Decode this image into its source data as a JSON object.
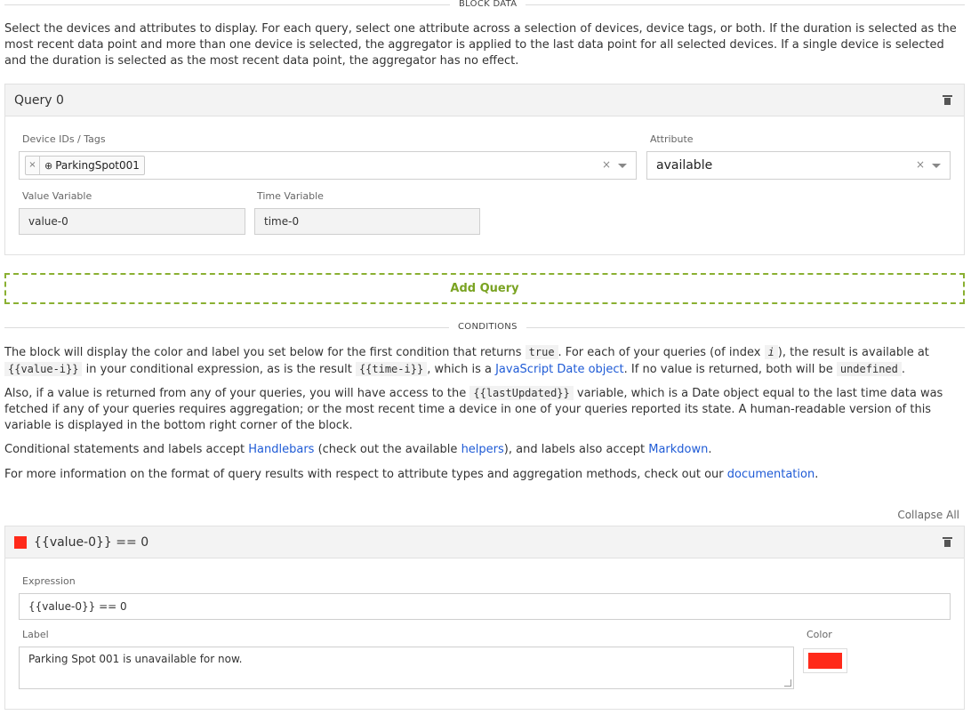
{
  "block_data": {
    "section_title": "BLOCK DATA",
    "intro": "Select the devices and attributes to display. For each query, select one attribute across a selection of devices, device tags, or both. If the duration is selected as the most recent data point and more than one device is selected, the aggregator is applied to the last data point for all selected devices. If a single device is selected and the duration is selected as the most recent data point, the aggregator has no effect."
  },
  "query": {
    "title": "Query 0",
    "device_label": "Device IDs / Tags",
    "device_chip": "ParkingSpot001",
    "device_chip_remove": "×",
    "device_chip_icon": "⊕",
    "attribute_label": "Attribute",
    "attribute_value": "available",
    "clear_symbol": "×",
    "value_var_label": "Value Variable",
    "value_var": "value-0",
    "time_var_label": "Time Variable",
    "time_var": "time-0"
  },
  "add_query_label": "Add Query",
  "conditions": {
    "section_title": "CONDITIONS",
    "p1_a": "The block will display the color and label you set below for the first condition that returns ",
    "p1_code1": "true",
    "p1_b": ". For each of your queries (of index ",
    "p1_code2": "i",
    "p1_c": "), the result is available at ",
    "p1_code3": "{{value-i}}",
    "p1_d": " in your conditional expression, as is the result ",
    "p1_code4": "{{time-i}}",
    "p1_e": ", which is a ",
    "p1_link": "JavaScript Date object",
    "p1_f": ". If no value is returned, both will be ",
    "p1_code5": "undefined",
    "p1_g": ".",
    "p2_a": "Also, if a value is returned from any of your queries, you will have access to the ",
    "p2_code": "{{lastUpdated}}",
    "p2_b": " variable, which is a Date object equal to the last time data was fetched if any of your queries requires aggregation; or the most recent time a device in one of your queries reported its state. A human-readable version of this variable is displayed in the bottom right corner of the block.",
    "p3_a": "Conditional statements and labels accept ",
    "p3_link1": "Handlebars",
    "p3_b": " (check out the available ",
    "p3_link2": "helpers",
    "p3_c": "), and labels also accept ",
    "p3_link3": "Markdown",
    "p3_d": ".",
    "p4_a": "For more information on the format of query results with respect to attribute types and aggregation methods, check out our ",
    "p4_link": "documentation",
    "p4_b": ".",
    "collapse_all": "Collapse All"
  },
  "condition_item": {
    "title": "{{value-0}} == 0",
    "expression_label": "Expression",
    "expression": "{{value-0}} == 0",
    "label_label": "Label",
    "label_text": "Parking Spot 001 is unavailable for now.",
    "color_label": "Color",
    "color_hex": "#ff2a1a"
  }
}
